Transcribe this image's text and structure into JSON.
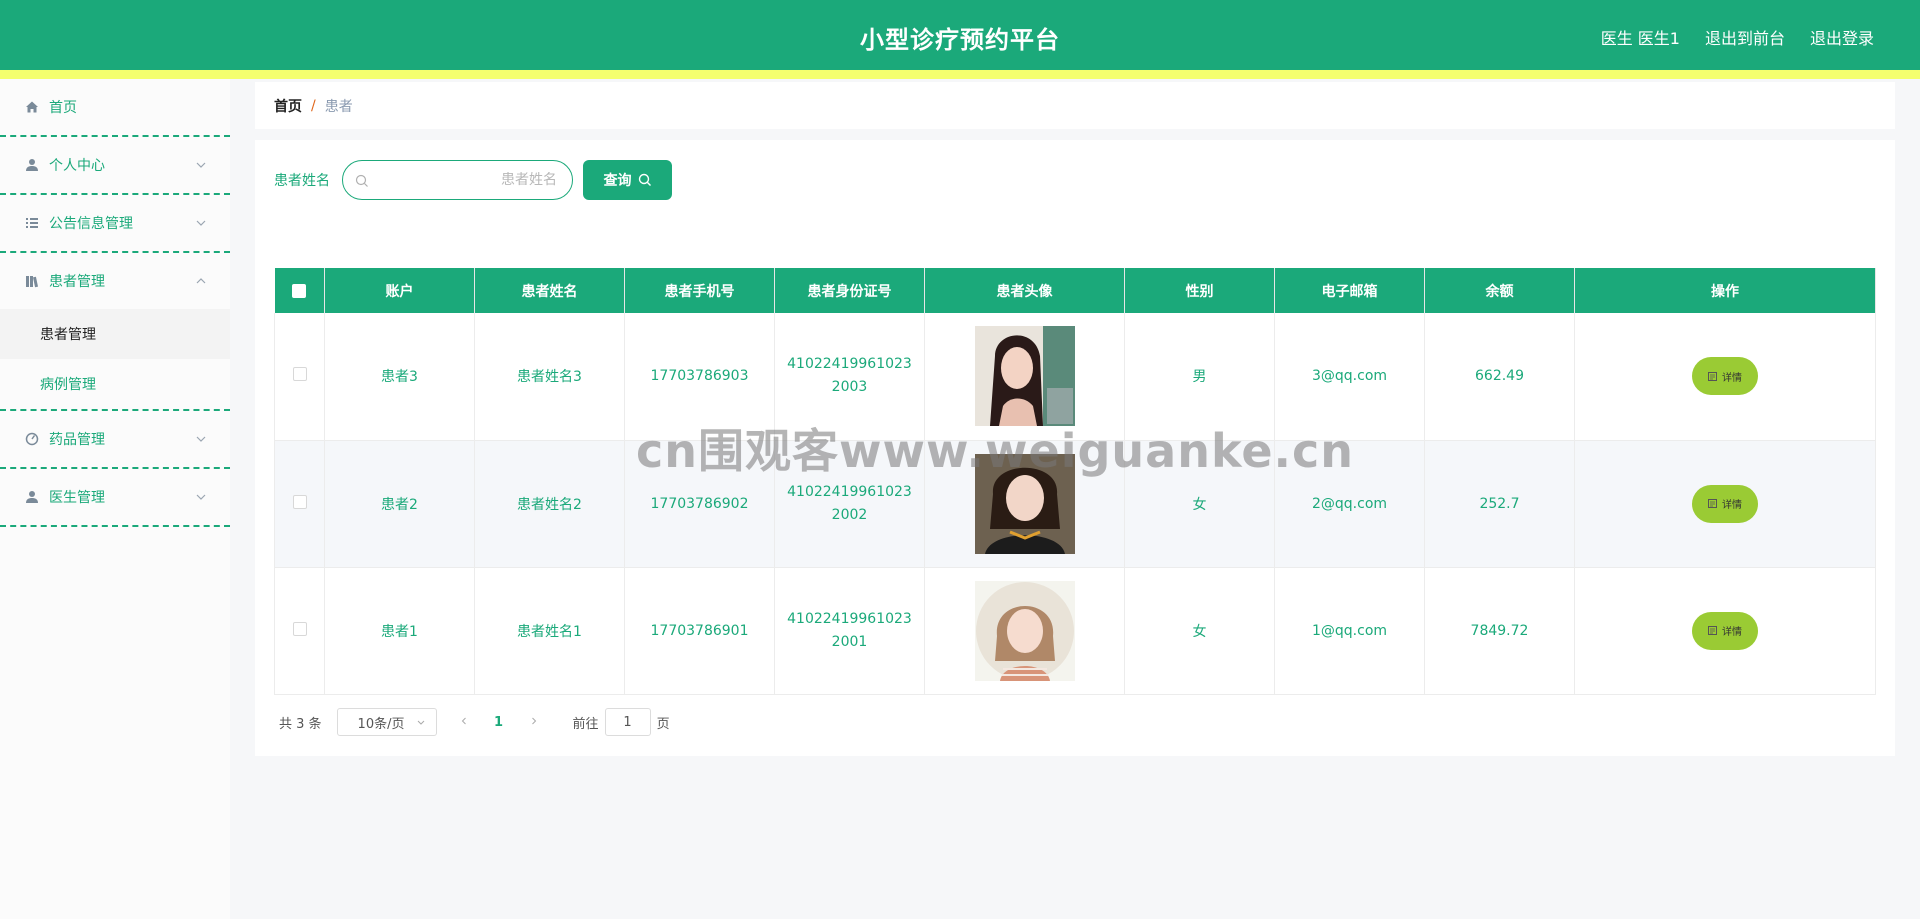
{
  "header": {
    "title": "小型诊疗预约平台",
    "links": [
      "医生 医生1",
      "退出到前台",
      "退出登录"
    ]
  },
  "sidebar": {
    "items": [
      {
        "label": "首页",
        "icon": "home-icon"
      },
      {
        "label": "个人中心",
        "icon": "user-icon"
      },
      {
        "label": "公告信息管理",
        "icon": "list-icon"
      },
      {
        "label": "患者管理",
        "icon": "books-icon",
        "expanded": true,
        "children": [
          {
            "label": "患者管理",
            "active": true
          },
          {
            "label": "病例管理"
          }
        ]
      },
      {
        "label": "药品管理",
        "icon": "gauge-icon"
      },
      {
        "label": "医生管理",
        "icon": "user-icon"
      }
    ]
  },
  "breadcrumb": {
    "home": "首页",
    "sep": "/",
    "current": "患者"
  },
  "search": {
    "label": "患者姓名",
    "placeholder": "患者姓名",
    "button": "查询"
  },
  "table": {
    "columns": [
      "账户",
      "患者姓名",
      "患者手机号",
      "患者身份证号",
      "患者头像",
      "性别",
      "电子邮箱",
      "余额",
      "操作"
    ],
    "rows": [
      {
        "account": "患者3",
        "name": "患者姓名3",
        "phone": "17703786903",
        "id_card": "410224199610232003",
        "avatar": "avatar-image",
        "gender": "男",
        "email": "3@qq.com",
        "balance": "662.49",
        "action": "详情"
      },
      {
        "account": "患者2",
        "name": "患者姓名2",
        "phone": "17703786902",
        "id_card": "410224199610232002",
        "avatar": "avatar-image",
        "gender": "女",
        "email": "2@qq.com",
        "balance": "252.7",
        "action": "详情"
      },
      {
        "account": "患者1",
        "name": "患者姓名1",
        "phone": "17703786901",
        "id_card": "410224199610232001",
        "avatar": "avatar-image",
        "gender": "女",
        "email": "1@qq.com",
        "balance": "7849.72",
        "action": "详情"
      }
    ]
  },
  "pagination": {
    "total": "共 3 条",
    "page_size": "10条/页",
    "current": "1",
    "goto_label": "前往",
    "goto_value": "1",
    "page_unit": "页"
  },
  "watermark": "cn围观客www.weiguanke.cn",
  "colors": {
    "primary": "#1ba97a",
    "stripe": "#f4ff6e",
    "detail_button": "#9acb34"
  }
}
